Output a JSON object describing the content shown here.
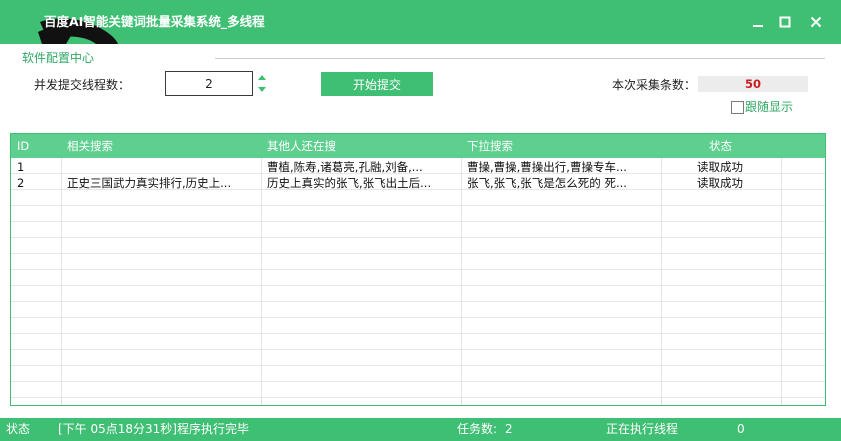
{
  "window": {
    "title": "百度AI智能关键词批量采集系统_多线程",
    "minimize_icon": "minimize-icon",
    "maximize_icon": "maximize-icon",
    "close_icon": "close-icon"
  },
  "config": {
    "section_label": "软件配置中心",
    "thread_label": "并发提交线程数：",
    "thread_value": "2",
    "start_label": "开始提交",
    "count_label": "本次采集条数：",
    "count_value": "50",
    "follow_label": "跟随显示",
    "follow_checked": false
  },
  "table": {
    "columns": [
      "ID",
      "相关搜索",
      "其他人还在搜",
      "下拉搜索",
      "状态"
    ],
    "rows": [
      [
        "1",
        "",
        "曹植,陈寿,诸葛亮,孔融,刘备,...",
        "曹操,曹操,曹操出行,曹操专车...",
        "读取成功"
      ],
      [
        "2",
        "正史三国武力真实排行,历史上...",
        "历史上真实的张飞,张飞出土后...",
        "张飞,张飞,张飞是怎么死的 死...",
        "读取成功"
      ]
    ]
  },
  "status": {
    "label": "状态",
    "message": "[下午 05点18分31秒]程序执行完毕",
    "tasks_label": "任务数:",
    "tasks_value": "2",
    "running_label": "正在执行线程",
    "running_value": "0"
  },
  "colors": {
    "accent": "#3fbf73",
    "header": "#5fcf8f",
    "count_value": "#c81e1e"
  }
}
